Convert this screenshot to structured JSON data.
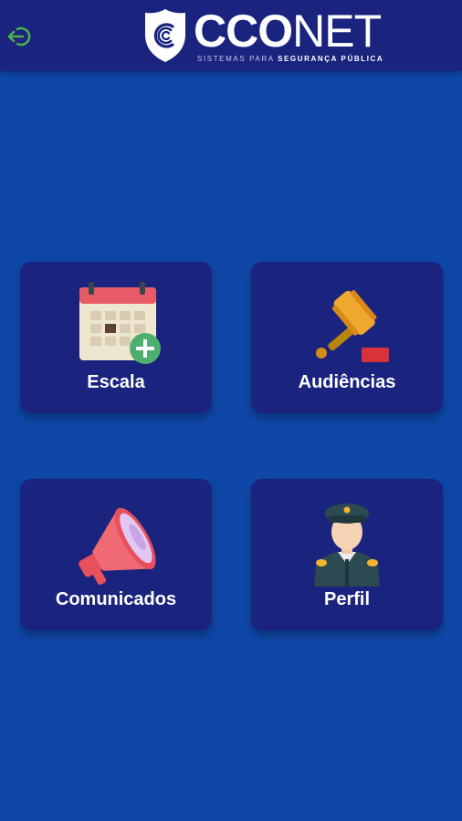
{
  "header": {
    "logout_icon": "logout-icon",
    "logo": {
      "brand_bold": "CCO",
      "brand_thin": "NET",
      "tagline_prefix": "SISTEMAS PARA ",
      "tagline_strong": "SEGURANÇA PÚBLICA"
    }
  },
  "menu": {
    "tiles": [
      {
        "label": "Escala",
        "icon": "calendar-add-icon"
      },
      {
        "label": "Audiências",
        "icon": "gavel-icon"
      },
      {
        "label": "Comunicados",
        "icon": "megaphone-icon"
      },
      {
        "label": "Perfil",
        "icon": "police-officer-icon"
      }
    ]
  },
  "colors": {
    "background": "#0f47a8",
    "header": "#1a237e",
    "tile": "#1a237e",
    "logout_icon": "#4caf50"
  }
}
